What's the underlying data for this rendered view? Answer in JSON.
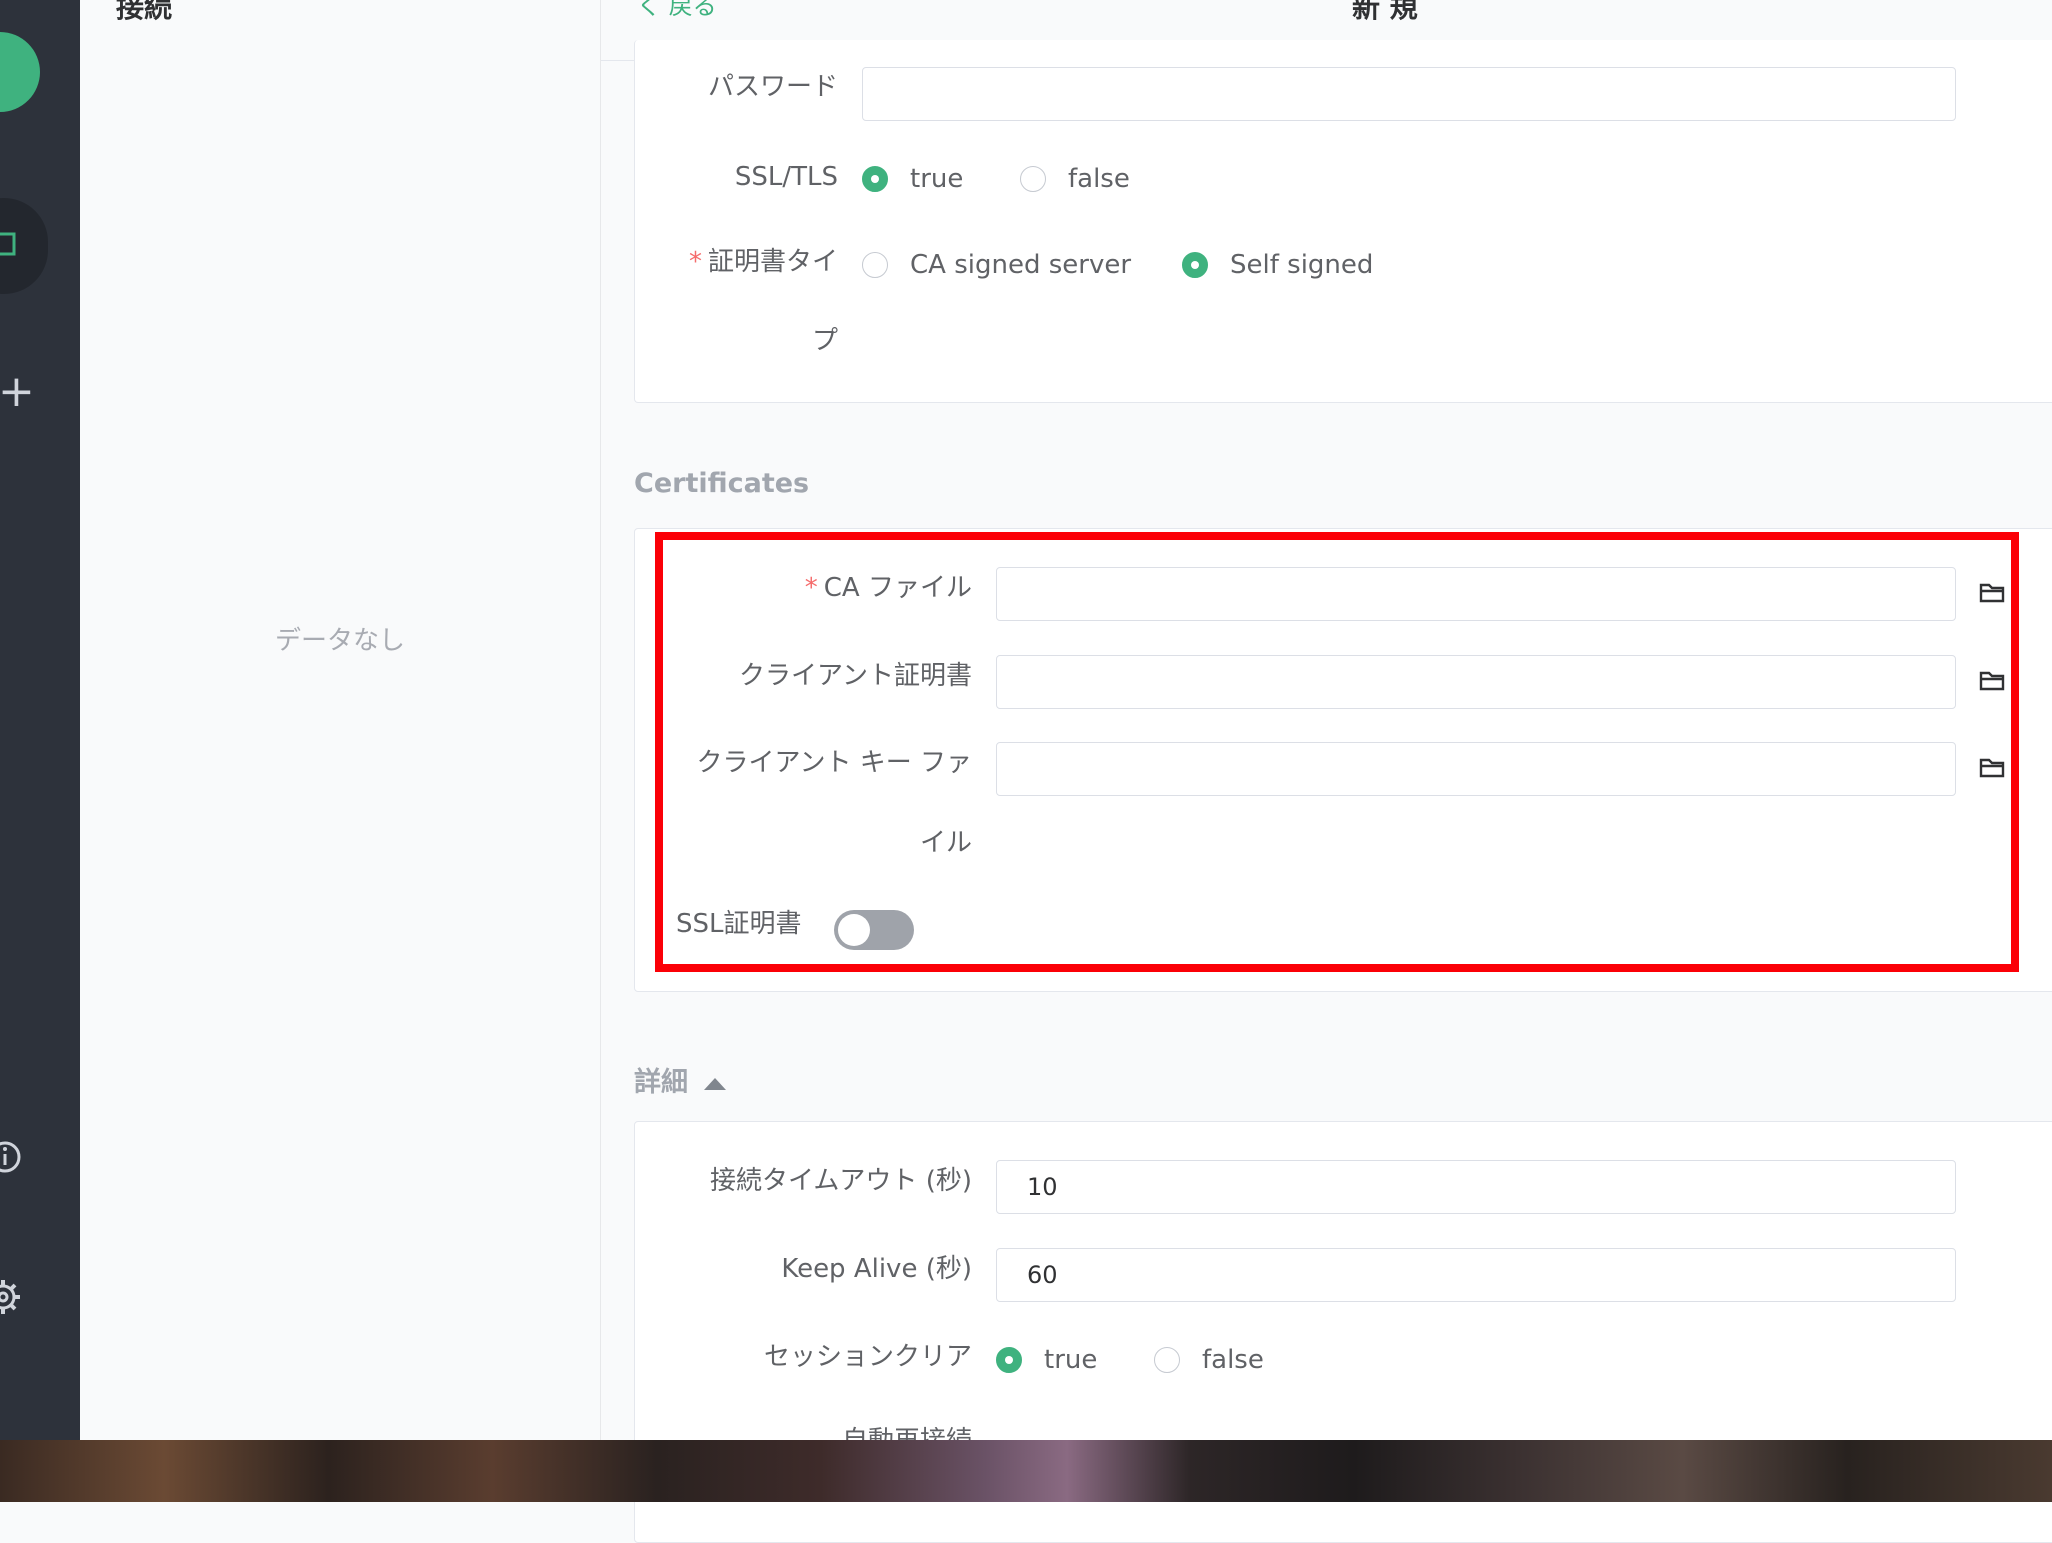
{
  "sidebar": {
    "icons": [
      "logo-x-icon",
      "connections-icon",
      "plus-icon",
      "info-icon",
      "gear-icon"
    ],
    "accent_color": "#3fb27f"
  },
  "list": {
    "title": "接続",
    "empty_text": "データなし"
  },
  "header": {
    "back": "く 戻る",
    "title": "新 規"
  },
  "general": {
    "password_label": "パスワード",
    "password_value": "",
    "ssl_label": "SSL/TLS",
    "ssl_options": [
      "true",
      "false"
    ],
    "ssl_selected": "true",
    "cert_type_label_1": "証明書タイ",
    "cert_type_label_2": "プ",
    "cert_type_required": "*",
    "cert_type_options": [
      "CA signed server",
      "Self signed"
    ],
    "cert_type_selected": "Self signed"
  },
  "certificates": {
    "section_title": "Certificates",
    "ca_required": "*",
    "ca_label": "CA ファイル",
    "client_cert_label": "クライアント証明書",
    "client_key_label_1": "クライアント キー ファ",
    "client_key_label_2": "イル",
    "ssl_cert_label": "SSL証明書",
    "ssl_cert_enabled": false,
    "highlight_color": "#fb0007"
  },
  "advanced": {
    "section_title": "詳細",
    "timeout_label": "接続タイムアウト (秒)",
    "timeout_value": "10",
    "keepalive_label": "Keep Alive (秒)",
    "keepalive_value": "60",
    "clean_session_label": "セッションクリア",
    "clean_session_options": [
      "true",
      "false"
    ],
    "clean_session_selected": "true",
    "reconnect_label": "自動再接続"
  }
}
